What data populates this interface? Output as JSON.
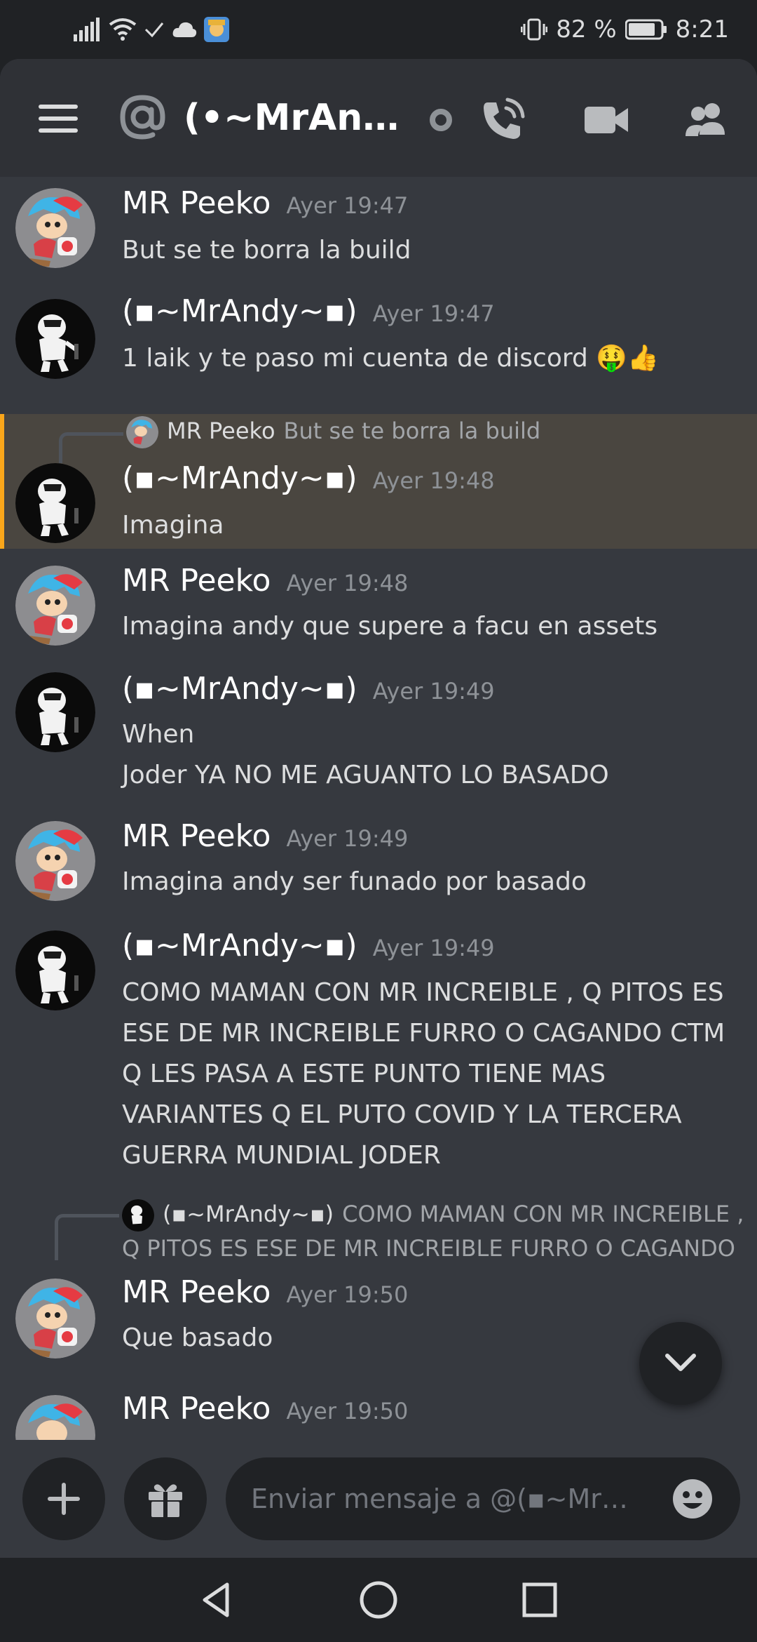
{
  "status_bar": {
    "battery_percent": "82 %",
    "time": "8:21"
  },
  "header": {
    "title": "(•~MrAnd...",
    "accent_color": "#faa61a"
  },
  "messages": [
    {
      "author": "MR Peeko",
      "time": "Ayer 19:47",
      "lines": [
        "But se te borra la build"
      ]
    },
    {
      "author": "(▪~MrAndy~▪)",
      "time": "Ayer 19:47",
      "lines": [
        "1 laik y te paso mi cuenta de discord 🤑👍"
      ]
    },
    {
      "reply": {
        "author": "MR Peeko",
        "text": "But se te borra la build"
      },
      "author": "(▪~MrAndy~▪)",
      "time": "Ayer 19:48",
      "lines": [
        "Imagina"
      ]
    },
    {
      "author": "MR Peeko",
      "time": "Ayer 19:48",
      "lines": [
        "Imagina andy que supere a facu en assets"
      ]
    },
    {
      "author": "(▪~MrAndy~▪)",
      "time": "Ayer 19:49",
      "lines": [
        "When",
        "Joder YA NO ME AGUANTO LO BASADO"
      ]
    },
    {
      "author": "MR Peeko",
      "time": "Ayer 19:49",
      "lines": [
        "Imagina andy ser funado por basado"
      ]
    },
    {
      "author": "(▪~MrAndy~▪)",
      "time": "Ayer 19:49",
      "lines": [
        "COMO MAMAN CON MR INCREIBLE , Q PITOS ES",
        "ESE DE MR INCREIBLE FURRO O CAGANDO CTM",
        "Q LES PASA A ESTE PUNTO TIENE MAS",
        "VARIANTES Q EL PUTO COVID Y LA TERCERA",
        "GUERRA MUNDIAL JODER"
      ]
    },
    {
      "reply": {
        "author": "(▪~MrAndy~▪)",
        "text": "COMO MAMAN CON MR INCREIBLE ,",
        "text2": "Q PITOS ES ESE DE MR INCREIBLE FURRO O CAGANDO"
      },
      "author": "MR Peeko",
      "time": "Ayer 19:50",
      "lines": [
        "Que basado"
      ]
    },
    {
      "author": "MR Peeko",
      "time": "Ayer 19:50",
      "lines": []
    }
  ],
  "composer": {
    "placeholder": "Enviar mensaje a @(▪~MrAnd..."
  }
}
